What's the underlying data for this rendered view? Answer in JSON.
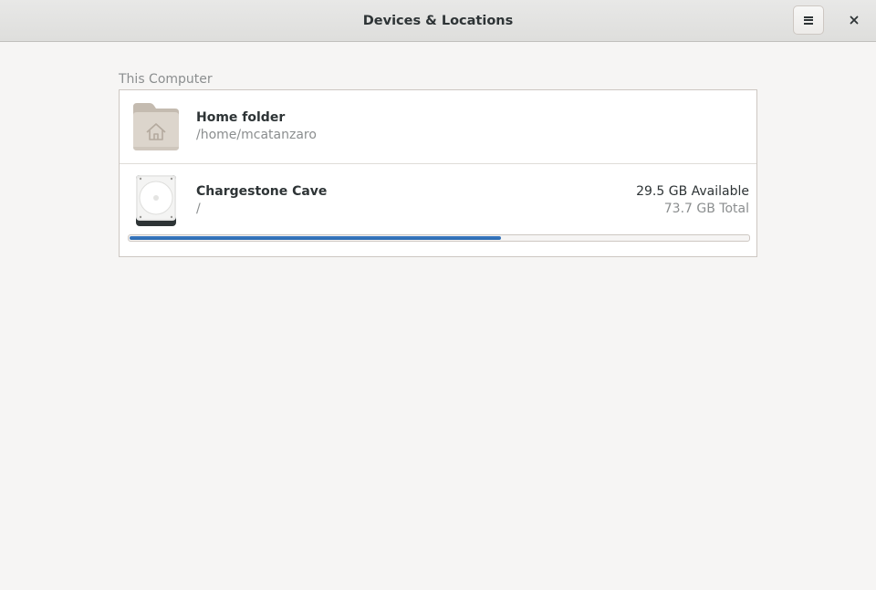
{
  "window": {
    "title": "Devices & Locations"
  },
  "header": {
    "menu_icon": "hamburger-menu-icon",
    "close_icon": "close-icon"
  },
  "section": {
    "label": "This Computer"
  },
  "locations": [
    {
      "name": "Home folder",
      "path": "/home/mcatanzaro",
      "icon": "home-folder-icon"
    },
    {
      "name": "Chargestone Cave",
      "path": "/",
      "icon": "hard-disk-icon",
      "available": "29.5 GB Available",
      "total": "73.7 GB Total",
      "used_fraction": 0.6
    }
  ],
  "colors": {
    "accent": "#2a6ab0",
    "background": "#f6f5f4",
    "folder": "#d6cfc6"
  }
}
